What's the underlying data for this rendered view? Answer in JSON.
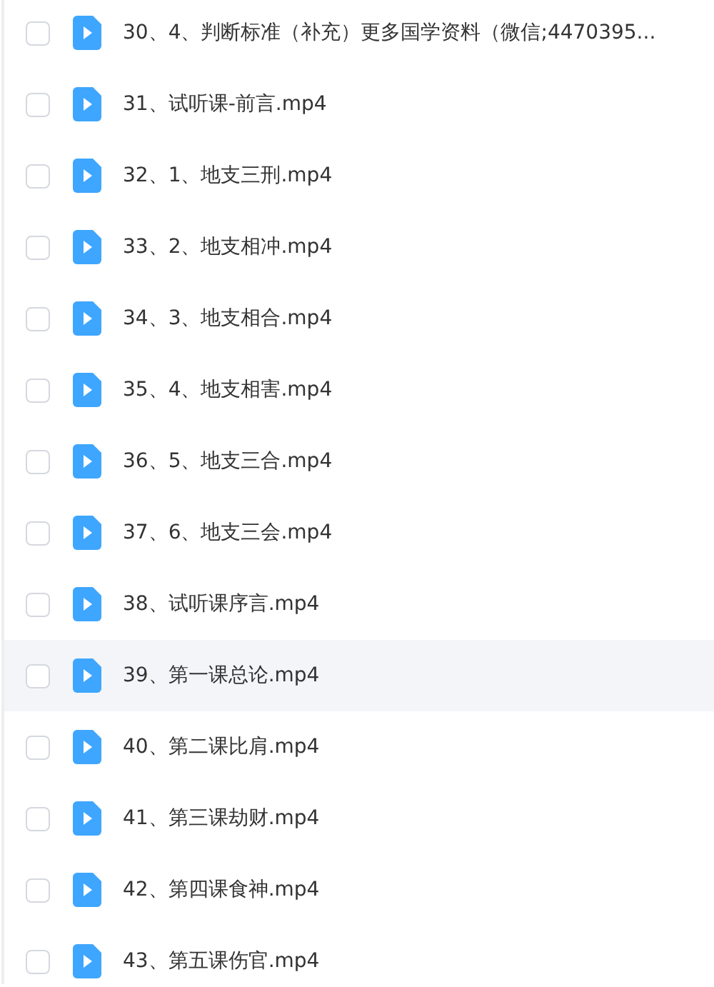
{
  "files": [
    {
      "name": "30、4、判断标准（补充）更多国学资料（微信;4470395...",
      "checked": false,
      "hovered": false
    },
    {
      "name": "31、试听课-前言.mp4",
      "checked": false,
      "hovered": false
    },
    {
      "name": "32、1、地支三刑.mp4",
      "checked": false,
      "hovered": false
    },
    {
      "name": "33、2、地支相冲.mp4",
      "checked": false,
      "hovered": false
    },
    {
      "name": "34、3、地支相合.mp4",
      "checked": false,
      "hovered": false
    },
    {
      "name": "35、4、地支相害.mp4",
      "checked": false,
      "hovered": false
    },
    {
      "name": "36、5、地支三合.mp4",
      "checked": false,
      "hovered": false
    },
    {
      "name": "37、6、地支三会.mp4",
      "checked": false,
      "hovered": false
    },
    {
      "name": "38、试听课序言.mp4",
      "checked": false,
      "hovered": false
    },
    {
      "name": "39、第一课总论.mp4",
      "checked": false,
      "hovered": true
    },
    {
      "name": "40、第二课比肩.mp4",
      "checked": false,
      "hovered": false
    },
    {
      "name": "41、第三课劫财.mp4",
      "checked": false,
      "hovered": false
    },
    {
      "name": "42、第四课食神.mp4",
      "checked": false,
      "hovered": false
    },
    {
      "name": "43、第五课伤官.mp4",
      "checked": false,
      "hovered": false
    }
  ]
}
